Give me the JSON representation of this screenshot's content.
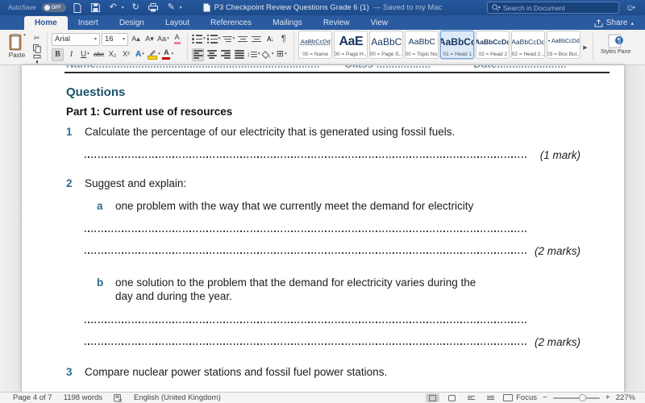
{
  "titlebar": {
    "autosave_label": "AutoSave",
    "autosave_state": "OFF",
    "title": "P3 Checkpoint Review Questions Grade 6 (1)",
    "saved_status": "— Saved to my Mac",
    "search_placeholder": "Search in Document"
  },
  "tabs": [
    {
      "label": "Home"
    },
    {
      "label": "Insert"
    },
    {
      "label": "Design"
    },
    {
      "label": "Layout"
    },
    {
      "label": "References"
    },
    {
      "label": "Mailings"
    },
    {
      "label": "Review"
    },
    {
      "label": "View"
    }
  ],
  "share_label": "Share",
  "icons": {
    "caret_down": "▾",
    "caret_up": "▴",
    "more_right": "▶",
    "undo": "↶",
    "redo": "↻",
    "pen": "✎",
    "smiley": "☺",
    "cut": "✂",
    "paragraph_mark": "¶",
    "borders_grid": "⊞",
    "sort": "A↓",
    "line_spacing": "↕"
  },
  "ribbon": {
    "paste_label": "Paste",
    "font_name": "Arial",
    "font_size": "16",
    "bold": "B",
    "italic": "I",
    "underline": "U",
    "strikethrough": "abc",
    "subscript": "X₂",
    "superscript": "X²",
    "increase_font": "A▴",
    "decrease_font": "A▾",
    "change_case": "Aa",
    "clear_formatting": "A",
    "text_effects": "A",
    "font_color_letter": "A",
    "styles": [
      {
        "sample": "AaBbCcDd",
        "label": "00 = Name"
      },
      {
        "sample": "AaE",
        "label": "00 = Page H..."
      },
      {
        "sample": "AaBbC",
        "label": "00 = Page S..."
      },
      {
        "sample": "AaBbC",
        "label": "00 = Topic No."
      },
      {
        "sample": "AaBbCc",
        "label": "01 = Head 1"
      },
      {
        "sample": "AaBbCcDd",
        "label": "02 = Head 2"
      },
      {
        "sample": "AaBbCcDd",
        "label": "02 = Head 2..."
      },
      {
        "sample": "• AaBbCcDd",
        "label": "03 = Box Bul..."
      }
    ],
    "styles_pane_label": "Styles Pane"
  },
  "document": {
    "name_line": "Name..........................................................................",
    "class_line": "Class ..................",
    "date_line": "Date.......................",
    "heading": "Questions",
    "part_heading": "Part 1: Current use of resources",
    "questions": {
      "q1_num": "1",
      "q1_text": "Calculate the percentage of our electricity that is generated using fossil fuels.",
      "q1_marks": "(1 mark)",
      "q2_num": "2",
      "q2_text": "Suggest and explain:",
      "q2a_letter": "a",
      "q2a_text": "one problem with the way that we currently meet the demand for electricity",
      "q2a_marks": "(2 marks)",
      "q2b_letter": "b",
      "q2b_text": "one solution to the problem that the demand for electricity varies during the day and during the year.",
      "q2b_marks": "(2 marks)",
      "q3_num": "3",
      "q3_text": "Compare nuclear power stations and fossil fuel power stations."
    }
  },
  "statusbar": {
    "page": "Page 4 of 7",
    "words": "1198 words",
    "language": "English (United Kingdom)",
    "focus_label": "Focus",
    "zoom_out": "−",
    "zoom_in": "+",
    "zoom_level": "227%"
  },
  "colors": {
    "titlebar_blue": "#1e4e8c",
    "accent_blue": "#2b579a",
    "heading_teal": "#1b516b",
    "question_number_blue": "#2e6b8d"
  }
}
